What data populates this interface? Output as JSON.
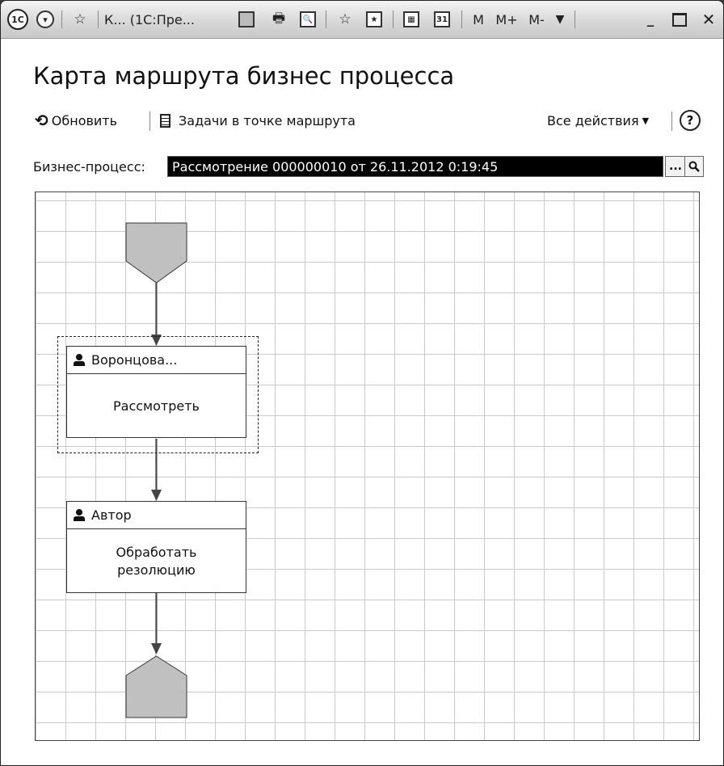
{
  "window": {
    "title_short": "К... (1С:Пре...",
    "calc_buttons": [
      "M",
      "M+",
      "M-"
    ],
    "logo_text": "1С"
  },
  "form": {
    "title": "Карта маршрута бизнес процесса"
  },
  "toolbar": {
    "refresh_label": "Обновить",
    "tasks_label": "Задачи в точке маршрута",
    "all_actions_label": "Все действия",
    "help_label": "?"
  },
  "process_field": {
    "label": "Бизнес-процесс:",
    "value": "Рассмотрение 000000010 от 26.11.2012 0:19:45",
    "select_button": "...",
    "open_button_icon": "magnifier-icon"
  },
  "route_map": {
    "start_point": "start-shape",
    "nodes": [
      {
        "performer": "Воронцова...",
        "task": "Рассмотреть",
        "selected": true
      },
      {
        "performer": "Автор",
        "task": "Обработать\nрезолюцию",
        "selected": false
      }
    ],
    "end_point": "end-shape"
  },
  "colors": {
    "grid_line": "#c9c9c9",
    "shape_fill": "#c0c0c0",
    "field_bg": "#000000",
    "field_text": "#ffffff"
  }
}
